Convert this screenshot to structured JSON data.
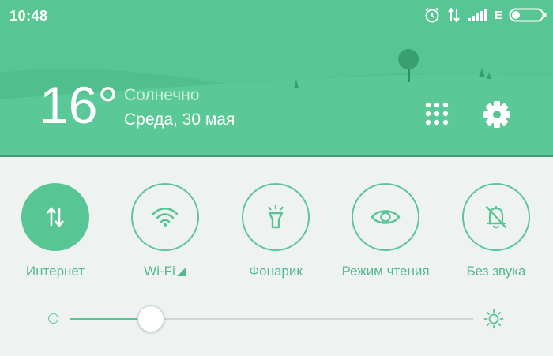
{
  "statusbar": {
    "time": "10:48",
    "network_type": "E",
    "icons": [
      "alarm-icon",
      "data-transfer-icon",
      "cell-signal-icon",
      "battery-icon"
    ]
  },
  "weather": {
    "temperature": "16°",
    "condition": "Солнечно",
    "date": "Среда, 30 мая"
  },
  "header_actions": [
    "apps-grid-icon",
    "settings-gear-icon"
  ],
  "toggles": [
    {
      "id": "internet",
      "label": "Интернет",
      "icon": "mobile-data-icon",
      "active": true
    },
    {
      "id": "wifi",
      "label": "Wi-Fi",
      "icon": "wifi-icon",
      "active": false
    },
    {
      "id": "flashlight",
      "label": "Фонарик",
      "icon": "flashlight-icon",
      "active": false
    },
    {
      "id": "reading",
      "label": "Режим чтения",
      "icon": "eye-icon",
      "active": false
    },
    {
      "id": "silent",
      "label": "Без звука",
      "icon": "bell-off-icon",
      "active": false
    }
  ],
  "brightness": {
    "level": 0.2
  },
  "colors": {
    "accent": "#58c594",
    "header_bg": "#58c594",
    "panel_bg": "#eef3f2",
    "hill_dark": "#4cb887",
    "hill_light": "#5cc99a"
  }
}
